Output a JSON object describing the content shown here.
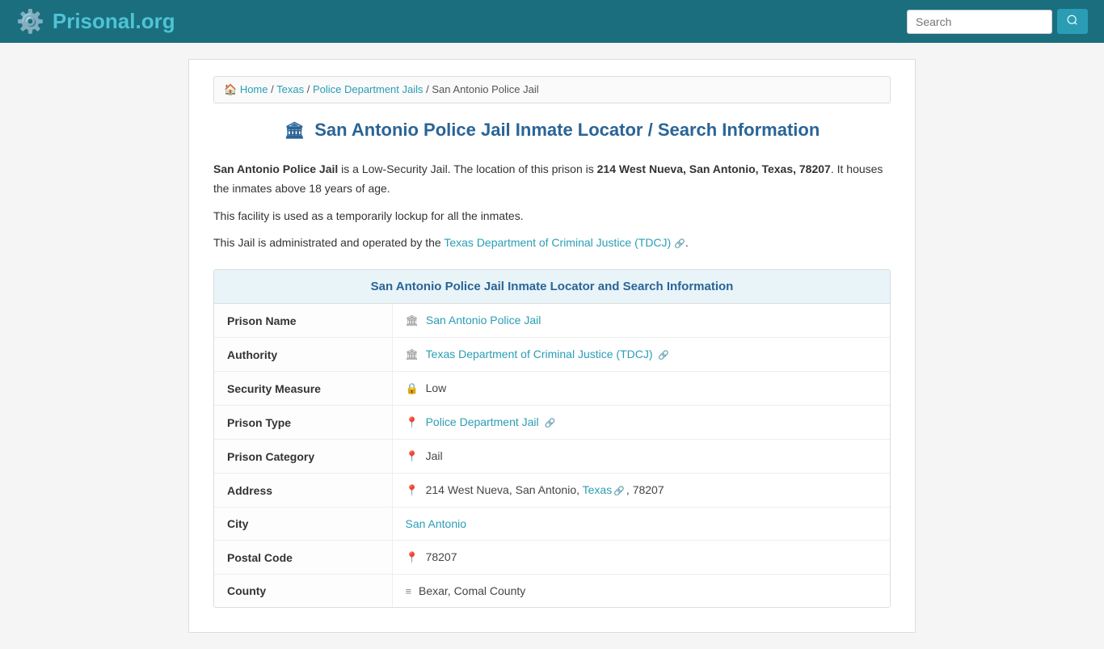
{
  "header": {
    "logo_main": "Prisonal",
    "logo_accent": ".org",
    "search_placeholder": "Search",
    "search_button_label": "🔍"
  },
  "breadcrumb": {
    "home": "Home",
    "state": "Texas",
    "type": "Police Department Jails",
    "current": "San Antonio Police Jail"
  },
  "page": {
    "title_icon": "🏛",
    "title": "San Antonio Police Jail Inmate Locator / Search Information"
  },
  "description": {
    "line1_part1": "San Antonio Police Jail",
    "line1_part2": " is a Low-Security Jail. The location of this prison is ",
    "line1_bold": "214 West Nueva, San Antonio, Texas, 78207",
    "line1_part3": ". It houses the inmates above 18 years of age.",
    "line2": "This facility is used as a temporarily lockup for all the inmates.",
    "line3_part1": "This Jail is administrated and operated by the ",
    "line3_link": "Texas Department of Criminal Justice (TDCJ)",
    "line3_part2": "."
  },
  "table": {
    "section_title": "San Antonio Police Jail Inmate Locator and Search Information",
    "rows": [
      {
        "label": "Prison Name",
        "value": "San Antonio Police Jail",
        "is_link": true,
        "icon": "🏛"
      },
      {
        "label": "Authority",
        "value": "Texas Department of Criminal Justice (TDCJ)",
        "is_link": true,
        "icon": "🏛",
        "external": true
      },
      {
        "label": "Security Measure",
        "value": "Low",
        "is_link": false,
        "icon": "🔒"
      },
      {
        "label": "Prison Type",
        "value": "Police Department Jail",
        "is_link": true,
        "icon": "📍",
        "has_link_icon": true
      },
      {
        "label": "Prison Category",
        "value": "Jail",
        "is_link": false,
        "icon": "📍"
      },
      {
        "label": "Address",
        "value_parts": [
          "214 West Nueva, San Antonio, ",
          "Texas",
          ", 78207"
        ],
        "icon": "📍",
        "is_address": true
      },
      {
        "label": "City",
        "value": "San Antonio",
        "is_link": true,
        "icon": ""
      },
      {
        "label": "Postal Code",
        "value": "78207",
        "is_link": false,
        "icon": "📍"
      },
      {
        "label": "County",
        "value": "Bexar, Comal County",
        "is_link": false,
        "icon": "≡"
      }
    ]
  }
}
